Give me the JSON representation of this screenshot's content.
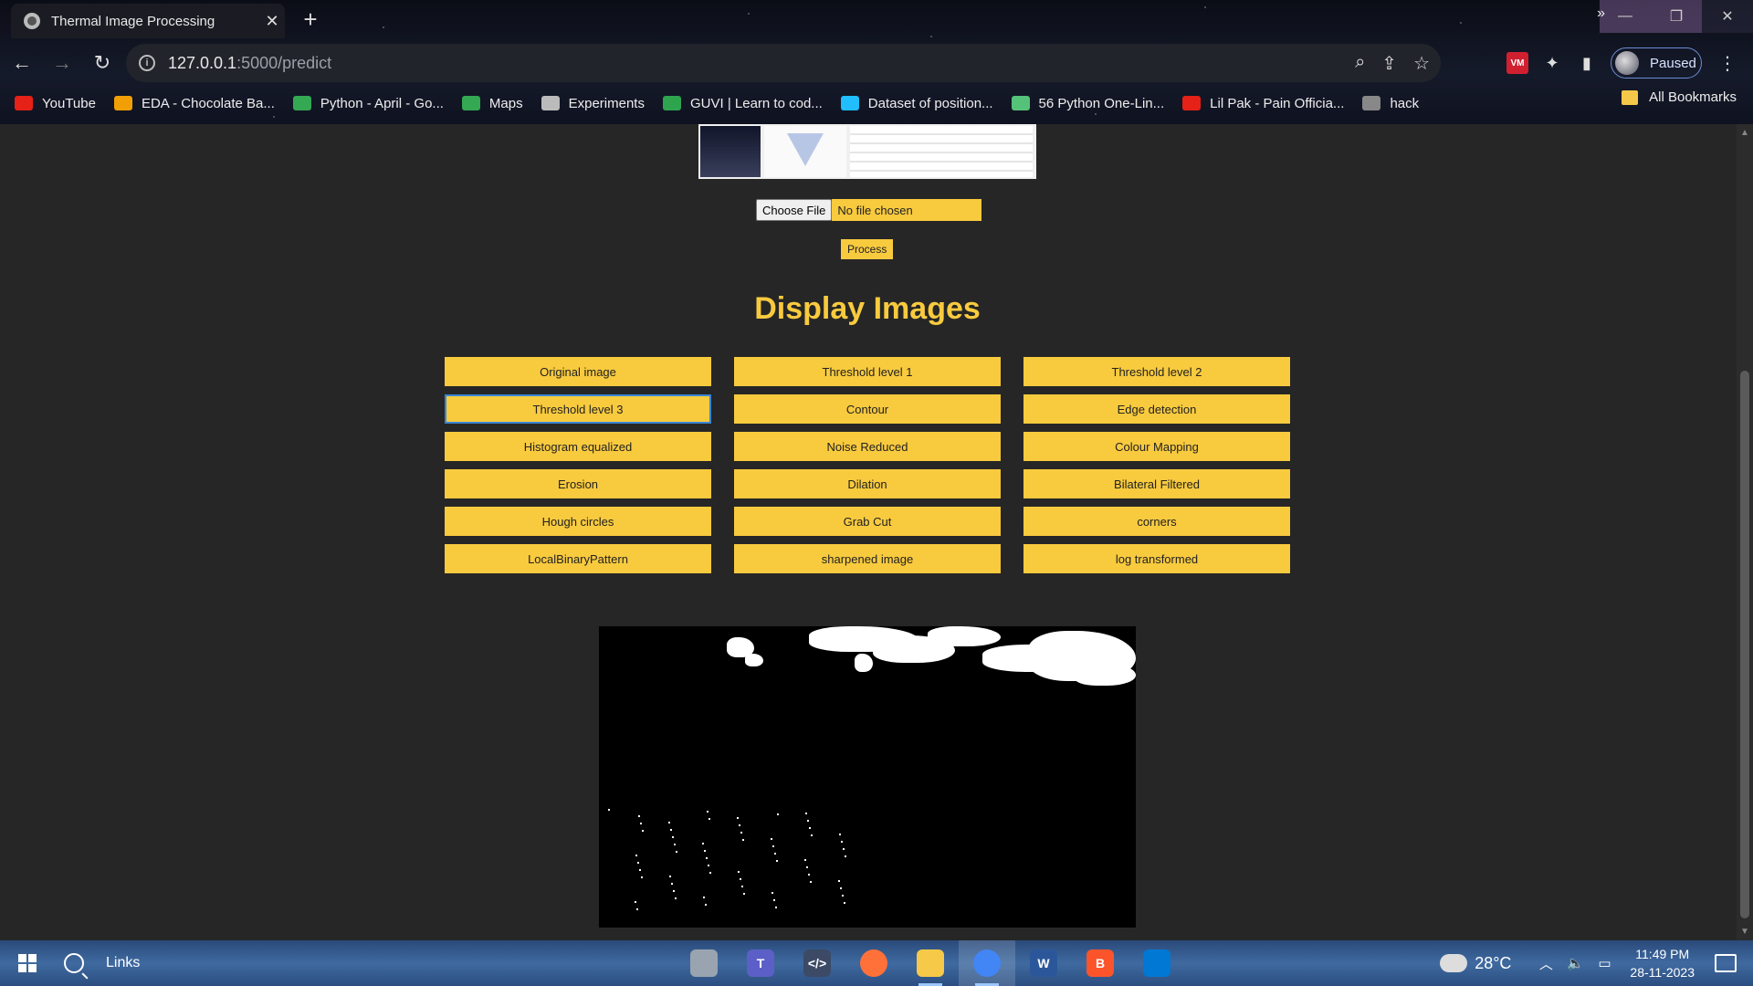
{
  "browser": {
    "tab_title": "Thermal Image Processing",
    "tab_close": "✕",
    "new_tab": "+",
    "url_host": "127.0.0.1",
    "url_path": ":5000/predict",
    "profile_label": "Paused",
    "ext_vm_label": "VM",
    "bookmarks": [
      {
        "label": "YouTube",
        "icon": "youtube-icon",
        "color": "#e62117"
      },
      {
        "label": "EDA - Chocolate Ba...",
        "icon": "co-icon",
        "color": "#f29f05"
      },
      {
        "label": "Python - April - Go...",
        "icon": "drive-icon",
        "color": "#34a853"
      },
      {
        "label": "Maps",
        "icon": "maps-icon",
        "color": "#34a853"
      },
      {
        "label": "Experiments",
        "icon": "flask-icon",
        "color": "#bbbbbb"
      },
      {
        "label": "GUVI | Learn to cod...",
        "icon": "guvi-icon",
        "color": "#2ea44f"
      },
      {
        "label": "Dataset of position...",
        "icon": "kaggle-icon",
        "color": "#20beff"
      },
      {
        "label": "56 Python One-Lin...",
        "icon": "fi-icon",
        "color": "#55c27a"
      },
      {
        "label": "Lil Pak - Pain Officia...",
        "icon": "youtube-icon",
        "color": "#e62117"
      },
      {
        "label": "hack",
        "icon": "globe-icon",
        "color": "#888888"
      }
    ],
    "bookmarks_overflow": "»",
    "all_bookmarks": "All Bookmarks"
  },
  "page": {
    "file_button": "Choose File",
    "file_status": "No file chosen",
    "process_button": "Process",
    "heading": "Display Images",
    "image_buttons": [
      "Original image",
      "Threshold level 1",
      "Threshold level 2",
      "Threshold level 3",
      "Contour",
      "Edge detection",
      "Histogram equalized",
      "Noise Reduced",
      "Colour Mapping",
      "Erosion",
      "Dilation",
      "Bilateral Filtered",
      "Hough circles",
      "Grab Cut",
      "corners",
      "LocalBinaryPattern",
      "sharpened image",
      "log transformed"
    ],
    "focused_button_index": 3,
    "accent_color": "#f8ca3e"
  },
  "taskbar": {
    "search_label": "Links",
    "apps": [
      {
        "name": "database-icon",
        "label": "",
        "color": "#9aa4b0"
      },
      {
        "name": "teams-icon",
        "label": "T",
        "color": "#5b5fc7"
      },
      {
        "name": "devtools-icon",
        "label": "</>",
        "color": "#3c4a66"
      },
      {
        "name": "firefox-icon",
        "label": "",
        "color": "#ff7139"
      },
      {
        "name": "explorer-icon",
        "label": "",
        "color": "#f7c948"
      },
      {
        "name": "chrome-icon",
        "label": "",
        "color": "#4285f4"
      },
      {
        "name": "word-icon",
        "label": "W",
        "color": "#2b579a"
      },
      {
        "name": "brave-icon",
        "label": "B",
        "color": "#fb542b"
      },
      {
        "name": "vscode-icon",
        "label": "",
        "color": "#0078d4"
      }
    ],
    "weather": "28°C",
    "time": "11:49 PM",
    "date": "28-11-2023"
  }
}
